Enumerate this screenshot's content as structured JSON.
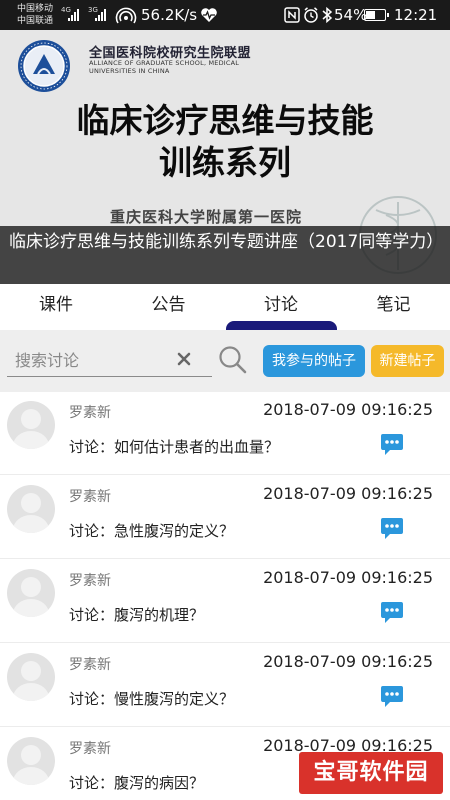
{
  "status_bar": {
    "carrier_1": "中国移动",
    "carrier_2": "中国联通",
    "net_1": "4G",
    "net_2": "3G",
    "speed": "56.2K/s",
    "battery_percent": "54%",
    "battery_level": 0.54,
    "time": "12:21"
  },
  "banner": {
    "org_cn": "全国医科院校研究生院联盟",
    "org_en_lines": [
      "ALLIANCE OF GRADUATE SCHOOL, MEDICAL",
      "UNIVERSITIES IN CHINA"
    ],
    "headline_lines": [
      "临床诊疗思维与技能",
      "训练系列"
    ],
    "hospital": "重庆医科大学附属第一医院",
    "caption": "临床诊疗思维与技能训练系列专题讲座（2017同等学力）"
  },
  "tabs": [
    {
      "label": "课件",
      "active": false
    },
    {
      "label": "公告",
      "active": false
    },
    {
      "label": "讨论",
      "active": true
    },
    {
      "label": "笔记",
      "active": false
    }
  ],
  "search": {
    "placeholder": "搜索讨论",
    "my_posts_label": "我参与的帖子",
    "new_post_label": "新建帖子"
  },
  "posts": [
    {
      "author": "罗素新",
      "time": "2018-07-09 09:16:25",
      "topic": "讨论：如何估计患者的出血量？"
    },
    {
      "author": "罗素新",
      "time": "2018-07-09 09:16:25",
      "topic": "讨论：急性腹泻的定义？"
    },
    {
      "author": "罗素新",
      "time": "2018-07-09 09:16:25",
      "topic": "讨论：腹泻的机理？"
    },
    {
      "author": "罗素新",
      "time": "2018-07-09 09:16:25",
      "topic": "讨论：慢性腹泻的定义？"
    },
    {
      "author": "罗素新",
      "time": "2018-07-09 09:16:25",
      "topic": "讨论：腹泻的病因？"
    }
  ],
  "watermark": "宝哥软件园",
  "colors": {
    "tab_indicator": "#1a1a7a",
    "button_blue": "#2b97dc",
    "button_orange": "#f5b92a",
    "chat_icon": "#2b97dc",
    "watermark_red": "#d9322b"
  },
  "icons": {
    "clear": "close-icon",
    "search": "search-icon",
    "comment": "chat-bubble-icon",
    "avatar": "default-avatar-icon"
  }
}
